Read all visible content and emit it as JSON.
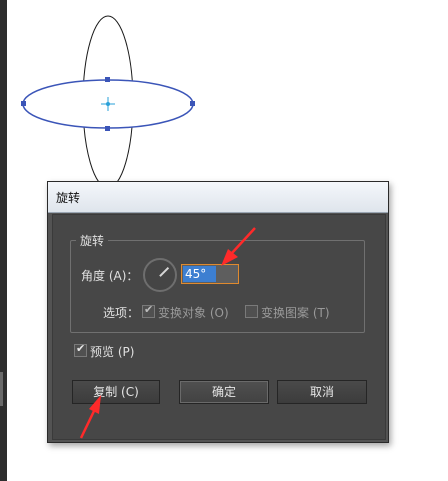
{
  "canvas": {
    "artwork": "two-ellipses-rotation"
  },
  "dialog": {
    "title": "旋转",
    "group_label": "旋转",
    "angle_label": "角度 (A)：",
    "angle_value": "45°",
    "options_label": "选项：",
    "transform_objects_label": "变换对象 (O)",
    "transform_objects_checked": true,
    "transform_patterns_label": "变换图案 (T)",
    "transform_patterns_checked": false,
    "preview_label": "预览 (P)",
    "preview_checked": true,
    "copy_button": "复制 (C)",
    "ok_button": "确定",
    "cancel_button": "取消"
  },
  "annotations": {
    "arrow_color": "#ff2a2a"
  }
}
